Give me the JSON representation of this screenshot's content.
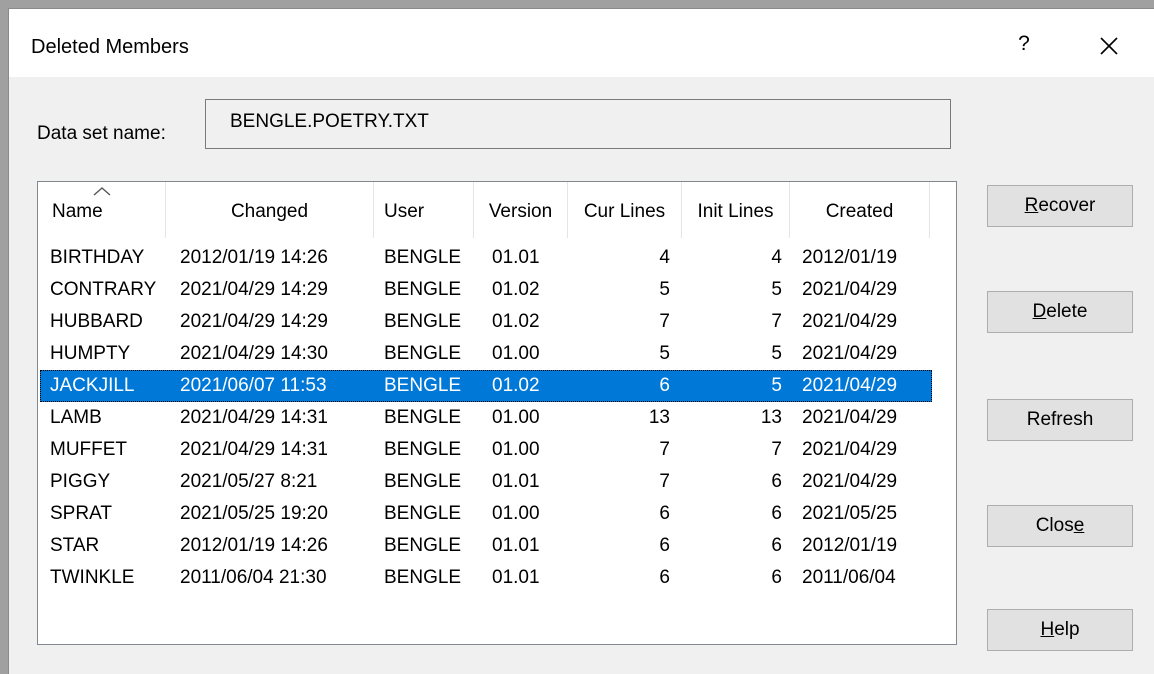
{
  "dialog": {
    "title": "Deleted Members",
    "help_glyph": "?",
    "close_glyph": "close-icon"
  },
  "dataset": {
    "label": "Data set name:",
    "value": "BENGLE.POETRY.TXT"
  },
  "table": {
    "sort_column": "Name",
    "sort_direction": "ascending",
    "columns": [
      "Name",
      "Changed",
      "User",
      "Version",
      "Cur Lines",
      "Init Lines",
      "Created"
    ],
    "rows": [
      {
        "name": "BIRTHDAY",
        "changed": "2012/01/19  14:26",
        "user": "BENGLE",
        "version": "01.01",
        "cur_lines": "4",
        "init_lines": "4",
        "created": "2012/01/19"
      },
      {
        "name": "CONTRARY",
        "changed": "2021/04/29  14:29",
        "user": "BENGLE",
        "version": "01.02",
        "cur_lines": "5",
        "init_lines": "5",
        "created": "2021/04/29"
      },
      {
        "name": "HUBBARD",
        "changed": "2021/04/29  14:29",
        "user": "BENGLE",
        "version": "01.02",
        "cur_lines": "7",
        "init_lines": "7",
        "created": "2021/04/29"
      },
      {
        "name": "HUMPTY",
        "changed": "2021/04/29  14:30",
        "user": "BENGLE",
        "version": "01.00",
        "cur_lines": "5",
        "init_lines": "5",
        "created": "2021/04/29"
      },
      {
        "name": "JACKJILL",
        "changed": "2021/06/07  11:53",
        "user": "BENGLE",
        "version": "01.02",
        "cur_lines": "6",
        "init_lines": "5",
        "created": "2021/04/29",
        "selected": true
      },
      {
        "name": "LAMB",
        "changed": "2021/04/29  14:31",
        "user": "BENGLE",
        "version": "01.00",
        "cur_lines": "13",
        "init_lines": "13",
        "created": "2021/04/29"
      },
      {
        "name": "MUFFET",
        "changed": "2021/04/29  14:31",
        "user": "BENGLE",
        "version": "01.00",
        "cur_lines": "7",
        "init_lines": "7",
        "created": "2021/04/29"
      },
      {
        "name": "PIGGY",
        "changed": "2021/05/27  8:21",
        "user": "BENGLE",
        "version": "01.01",
        "cur_lines": "7",
        "init_lines": "6",
        "created": "2021/04/29"
      },
      {
        "name": "SPRAT",
        "changed": "2021/05/25  19:20",
        "user": "BENGLE",
        "version": "01.00",
        "cur_lines": "6",
        "init_lines": "6",
        "created": "2021/05/25"
      },
      {
        "name": "STAR",
        "changed": "2012/01/19  14:26",
        "user": "BENGLE",
        "version": "01.01",
        "cur_lines": "6",
        "init_lines": "6",
        "created": "2012/01/19"
      },
      {
        "name": "TWINKLE",
        "changed": "2011/06/04  21:30",
        "user": "BENGLE",
        "version": "01.01",
        "cur_lines": "6",
        "init_lines": "6",
        "created": "2011/06/04"
      }
    ]
  },
  "buttons": {
    "recover": {
      "before": "",
      "key": "R",
      "after": "ecover"
    },
    "delete": {
      "before": "",
      "key": "D",
      "after": "elete"
    },
    "refresh": {
      "before": "Refresh",
      "key": "",
      "after": ""
    },
    "close": {
      "before": "Clos",
      "key": "e",
      "after": ""
    },
    "help": {
      "before": "",
      "key": "H",
      "after": "elp"
    }
  },
  "colors": {
    "selection": "#0078d7",
    "dialog_bg": "#f0f0f0",
    "button_bg": "#e1e1e1"
  }
}
